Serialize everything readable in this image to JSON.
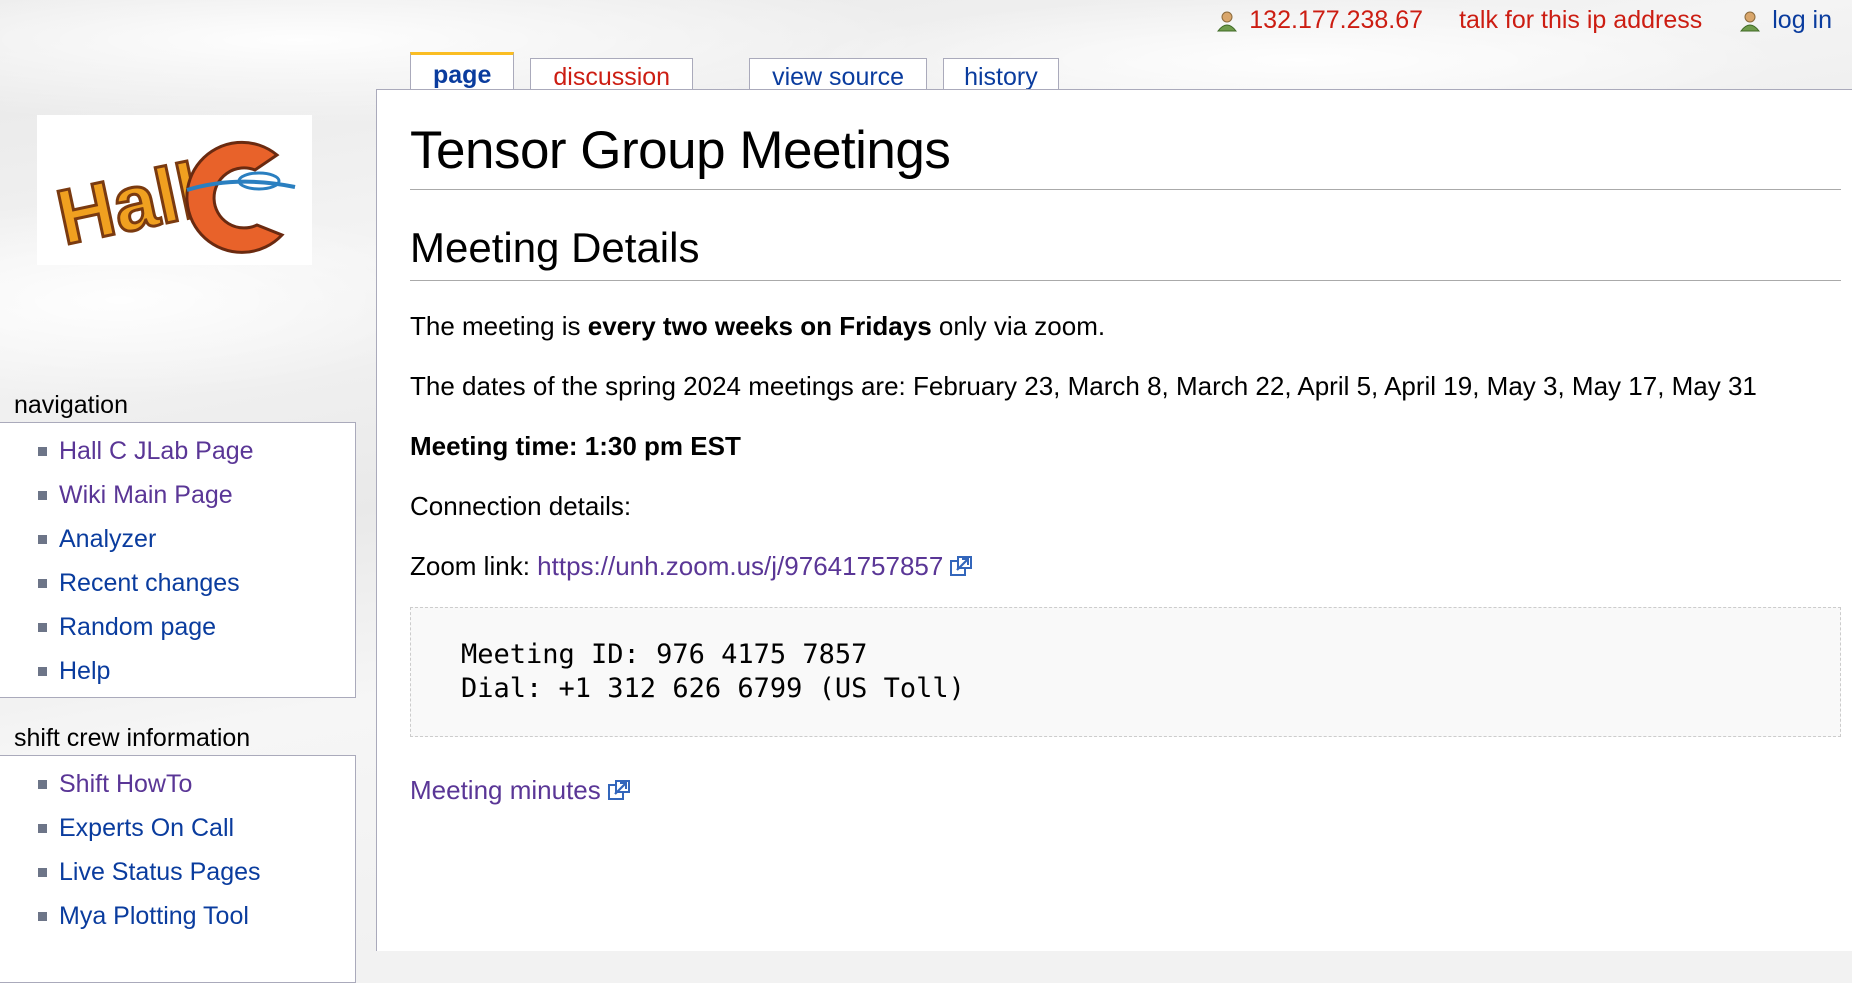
{
  "personal_bar": {
    "ip_address": "132.177.238.67",
    "talk_label": "talk for this ip address",
    "login_label": "log in"
  },
  "tabs": [
    {
      "label": "page",
      "selected": true
    },
    {
      "label": "discussion",
      "selected": false,
      "color": "red"
    },
    {
      "label": "view source",
      "selected": false
    },
    {
      "label": "history",
      "selected": false
    }
  ],
  "logo": {
    "text": "Hall C"
  },
  "sidebar": {
    "navigation": {
      "title": "navigation",
      "items": [
        "Hall C JLab Page",
        "Wiki Main Page",
        "Analyzer",
        "Recent changes",
        "Random page",
        "Help"
      ]
    },
    "shift_crew": {
      "title": "shift crew information",
      "items": [
        "Shift HowTo",
        "Experts On Call",
        "Live Status Pages",
        "Mya Plotting Tool"
      ]
    }
  },
  "article": {
    "title": "Tensor Group Meetings",
    "section_title": "Meeting Details",
    "line1_pre": "The meeting is ",
    "line1_bold": "every two weeks on Fridays",
    "line1_post": " only via zoom.",
    "dates": "The dates of the spring 2024 meetings are: February 23, March 8, March 22, April 5, April 19, May 3, May 17, May 31",
    "meeting_time": "Meeting time: 1:30 pm EST",
    "connection": "Connection details:",
    "zoom_label": "Zoom link: ",
    "zoom_url": "https://unh.zoom.us/j/97641757857",
    "box_line1": "Meeting ID: 976 4175 7857",
    "box_line2": "Dial: +1 312 626 6799 (US Toll)",
    "minutes_link": "Meeting minutes"
  },
  "colors": {
    "link": "#0a3c9e",
    "visited": "#5a3696",
    "new_link": "#cc1d12",
    "tab_accent": "#fabd23"
  }
}
